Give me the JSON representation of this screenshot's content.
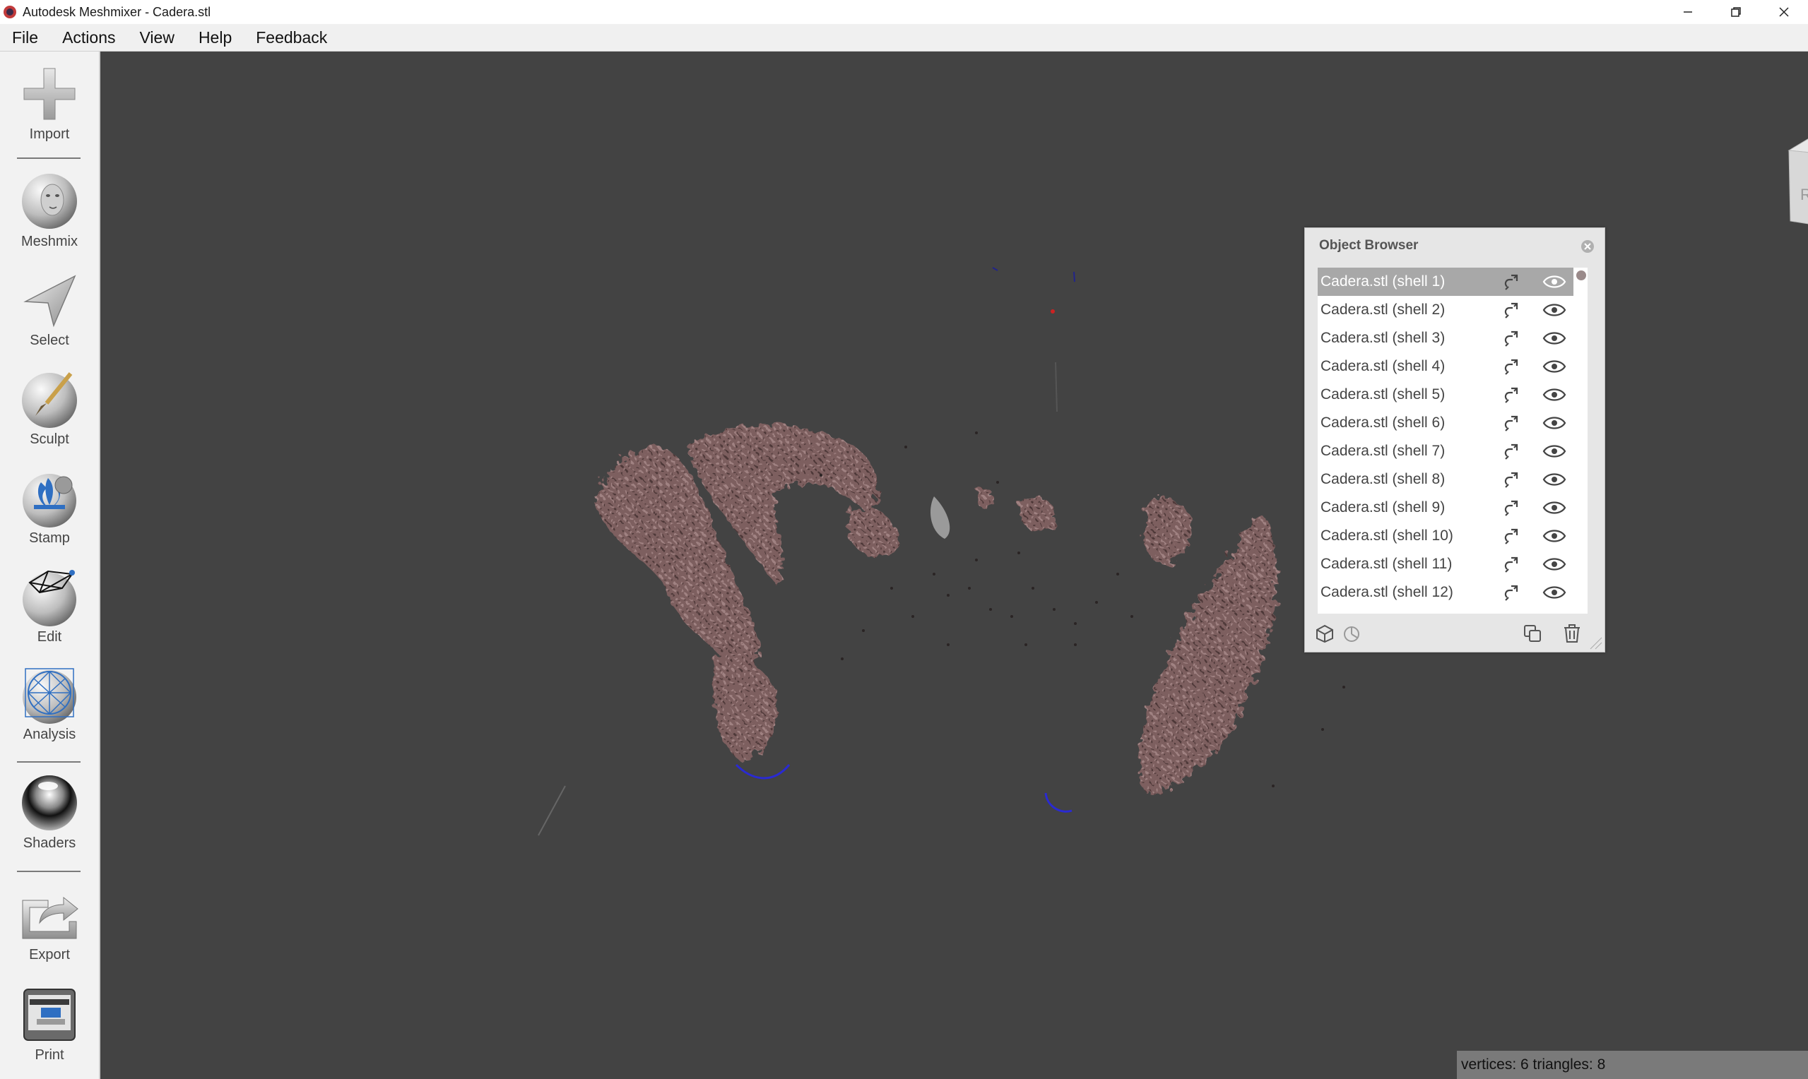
{
  "window": {
    "title": "Autodesk Meshmixer - Cadera.stl",
    "buttons": [
      "minimize",
      "restore",
      "close"
    ]
  },
  "menu": [
    "File",
    "Actions",
    "View",
    "Help",
    "Feedback"
  ],
  "toolbar": {
    "tools": [
      {
        "label": "Import",
        "icon": "plus-icon"
      },
      {
        "label": "Meshmix",
        "icon": "face-sphere-icon"
      },
      {
        "label": "Select",
        "icon": "arrow-pointer-icon"
      },
      {
        "label": "Sculpt",
        "icon": "brush-sphere-icon"
      },
      {
        "label": "Stamp",
        "icon": "stamp-sphere-icon"
      },
      {
        "label": "Edit",
        "icon": "wireframe-sphere-icon"
      },
      {
        "label": "Analysis",
        "icon": "mesh-sphere-icon"
      },
      {
        "label": "Shaders",
        "icon": "chrome-sphere-icon"
      },
      {
        "label": "Export",
        "icon": "export-icon"
      },
      {
        "label": "Print",
        "icon": "printer-icon"
      }
    ]
  },
  "viewcube": {
    "face_label": "RIGHT"
  },
  "object_browser": {
    "title": "Object Browser",
    "items": [
      {
        "name": "Cadera.stl (shell 1)",
        "selected": true
      },
      {
        "name": "Cadera.stl (shell 2)",
        "selected": false
      },
      {
        "name": "Cadera.stl (shell 3)",
        "selected": false
      },
      {
        "name": "Cadera.stl (shell 4)",
        "selected": false
      },
      {
        "name": "Cadera.stl (shell 5)",
        "selected": false
      },
      {
        "name": "Cadera.stl (shell 6)",
        "selected": false
      },
      {
        "name": "Cadera.stl (shell 7)",
        "selected": false
      },
      {
        "name": "Cadera.stl (shell 8)",
        "selected": false
      },
      {
        "name": "Cadera.stl (shell 9)",
        "selected": false
      },
      {
        "name": "Cadera.stl (shell 10)",
        "selected": false
      },
      {
        "name": "Cadera.stl (shell 11)",
        "selected": false
      },
      {
        "name": "Cadera.stl (shell 12)",
        "selected": false
      }
    ],
    "footer_icons": [
      "cube-icon",
      "pie-icon",
      "duplicate-icon",
      "trash-icon"
    ]
  },
  "status": {
    "text": "vertices: 6 triangles: 8"
  },
  "colors": {
    "viewport": "#434343",
    "mesh": "#7d5e5e",
    "selection_row": "#a8a8a8",
    "toolbar_bg": "#f2f2f2"
  }
}
